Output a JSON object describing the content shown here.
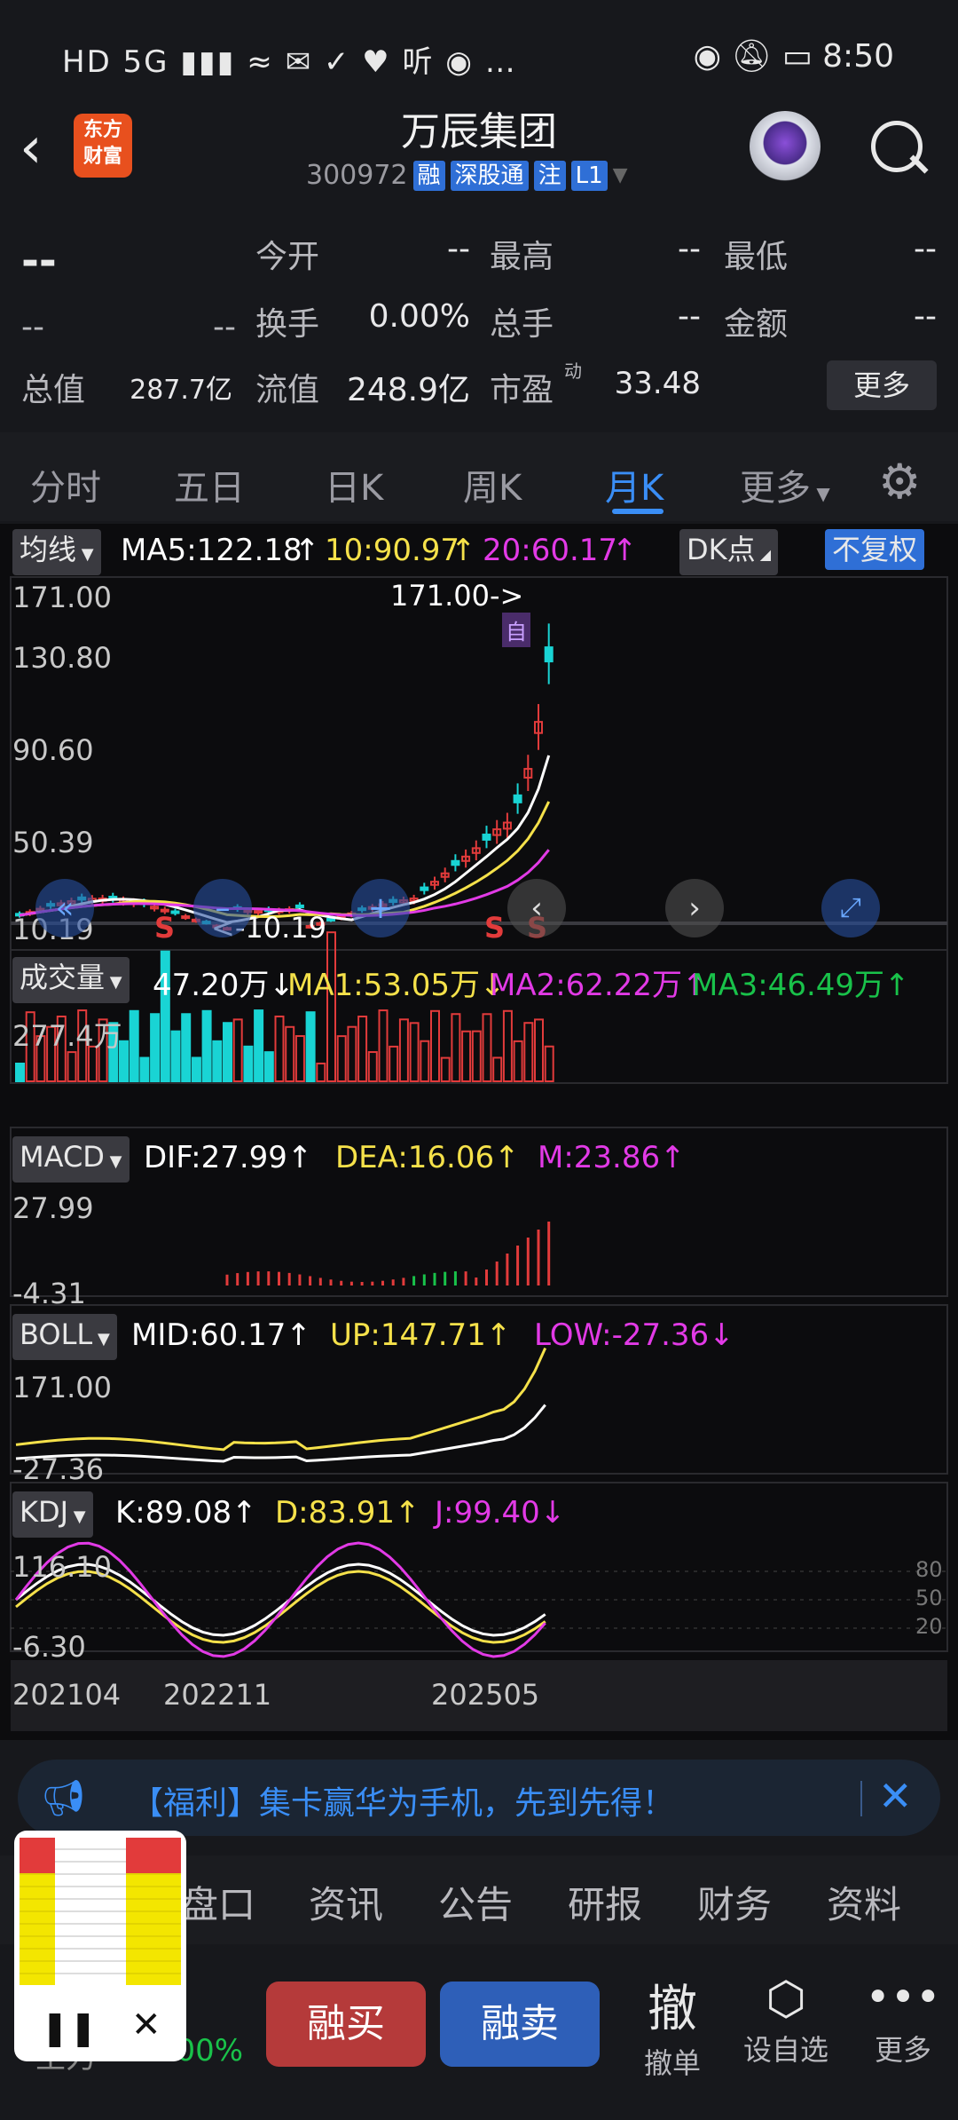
{
  "status": {
    "left": "HD 5G ▮▮▮ ≈ ✉ ✓ ♥ 听 ◉ …",
    "time": "8:50"
  },
  "header": {
    "logo_line1": "东方",
    "logo_line2": "财富",
    "title": "万辰集团",
    "code": "300972",
    "tags": [
      "融",
      "深股通",
      "注",
      "L1"
    ]
  },
  "quote": {
    "price": "--",
    "change": "--",
    "change2": "--",
    "labels": {
      "open": "今开",
      "high": "最高",
      "low": "最低",
      "turnover": "换手",
      "volume": "总手",
      "amount": "金额",
      "mktcap": "总值",
      "float": "流值",
      "pe": "市盈"
    },
    "values": {
      "open": "--",
      "high": "--",
      "low": "--",
      "turnover": "0.00%",
      "volume": "--",
      "amount": "--",
      "mktcap": "287.7亿",
      "float": "248.9亿",
      "pe": "33.48"
    },
    "more": "更多",
    "pe_sup": "动"
  },
  "tabs": {
    "items": [
      "分时",
      "五日",
      "日K",
      "周K",
      "月K",
      "更多"
    ],
    "active": "月K"
  },
  "ma": {
    "label": "均线",
    "ma5": "MA5:122.18",
    "ma10": "10:90.97",
    "ma20": "20:60.17",
    "dk": "DK点",
    "fq": "不复权"
  },
  "kline": {
    "ticks": [
      "171.00",
      "130.80",
      "90.60",
      "50.39",
      "10.19"
    ],
    "max_label": "171.00->",
    "min_label": "<-10.19",
    "marker": "自",
    "s1": "S",
    "s2": "S"
  },
  "vol": {
    "label": "成交量",
    "v": "47.20万",
    "ma1": "MA1:53.05万",
    "ma2": "MA2:62.22万",
    "ma3": "MA3:46.49万",
    "tick": "277.4万"
  },
  "macd": {
    "label": "MACD",
    "dif": "DIF:27.99",
    "dea": "DEA:16.06",
    "m": "M:23.86",
    "tick_top": "27.99",
    "tick_bot": "-4.31"
  },
  "boll": {
    "label": "BOLL",
    "mid": "MID:60.17",
    "up": "UP:147.71",
    "low": "LOW:-27.36",
    "tick_top": "171.00",
    "tick_bot": "-27.36"
  },
  "kdj": {
    "label": "KDJ",
    "k": "K:89.08",
    "d": "D:83.91",
    "j": "J:99.40",
    "tick_top": "116.10",
    "tick_bot": "-6.30",
    "r80": "80",
    "r50": "50",
    "r20": "20"
  },
  "dates": [
    "202104",
    "202211",
    "202505"
  ],
  "banner": {
    "text": "【福利】集卡赢华为手机，先到先得！"
  },
  "btabs": [
    "盘口",
    "资讯",
    "公告",
    "研报",
    "财务",
    "资料"
  ],
  "bottom": {
    "buy": "融买",
    "sell": "融卖",
    "cancel_big": "撤",
    "cancel": "撤单",
    "watch": "设自选",
    "more": "更多",
    "left_label": "主力",
    "left_val": "0.00%"
  },
  "colors": {
    "accent": "#3a8ef6",
    "up": "#e23b3b",
    "down": "#19d4d4",
    "ma5": "#ffffff",
    "ma10": "#f5e14a",
    "ma20": "#e23ae6"
  }
}
